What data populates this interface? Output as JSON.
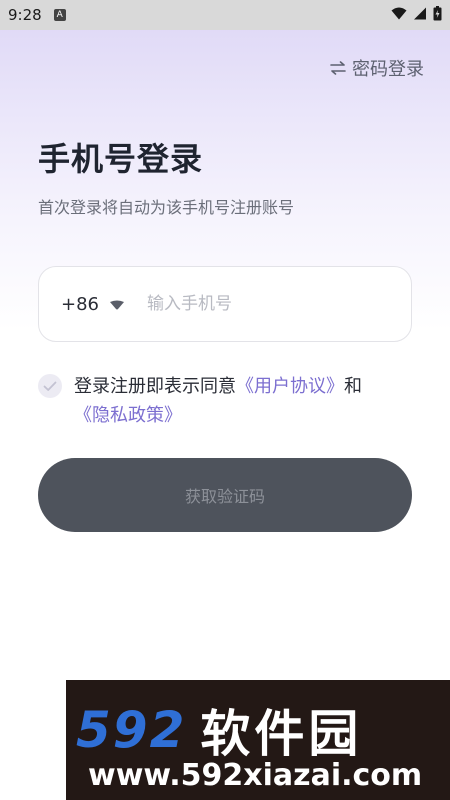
{
  "status_bar": {
    "time": "9:28",
    "notification_badge": "A",
    "icons": [
      "wifi-icon",
      "signal-icon",
      "battery-charging-icon"
    ]
  },
  "header": {
    "switch_label": "密码登录",
    "switch_icon": "swap-arrows-icon"
  },
  "main": {
    "title": "手机号登录",
    "subtitle": "首次登录将自动为该手机号注册账号",
    "phone": {
      "country_code": "+86",
      "value": "",
      "placeholder": "输入手机号"
    },
    "agreement": {
      "checked": false,
      "prefix": "登录注册即表示同意",
      "user_agreement_link": "《用户协议》",
      "conjunction": "和",
      "privacy_policy_link": "《隐私政策》"
    },
    "submit_label": "获取验证码"
  },
  "watermark": {
    "brand_number": "592",
    "brand_name": "软件园",
    "url": "www.592xiazai.com"
  },
  "colors": {
    "accent_link": "#7c6fd0",
    "button_bg": "#4e535c",
    "button_text": "#8d9199",
    "gradient_top": "#ddd6f6"
  }
}
